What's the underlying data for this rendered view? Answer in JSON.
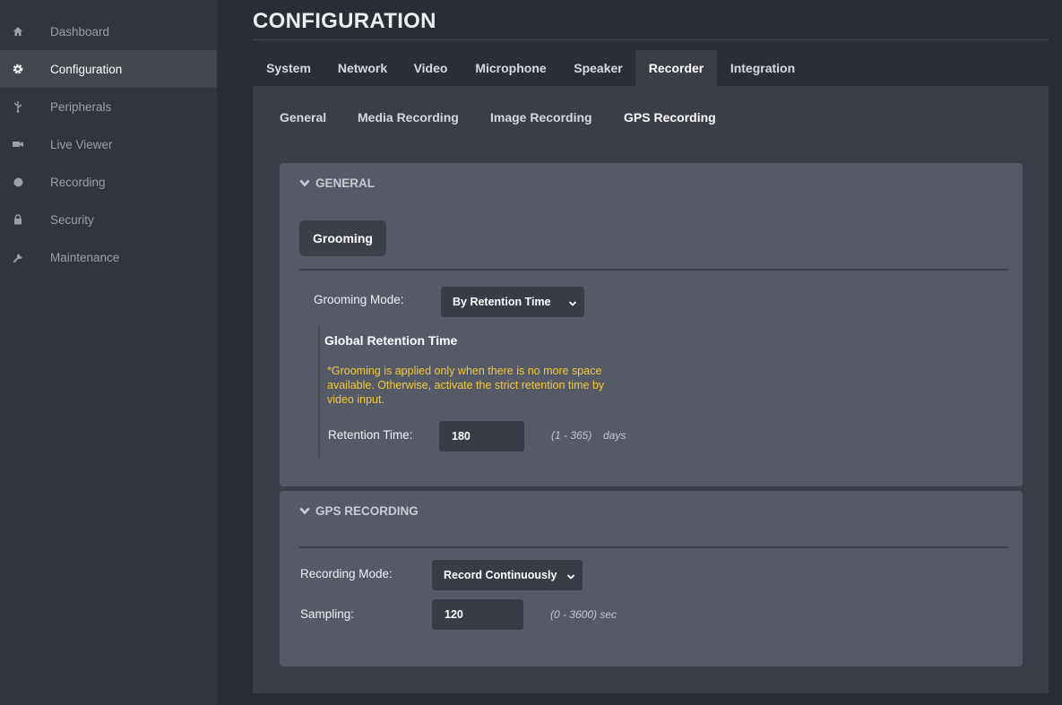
{
  "sidebar": {
    "items": [
      {
        "label": "Dashboard",
        "icon": "home-icon",
        "active": false
      },
      {
        "label": "Configuration",
        "icon": "gear-icon",
        "active": true
      },
      {
        "label": "Peripherals",
        "icon": "usb-icon",
        "active": false
      },
      {
        "label": "Live Viewer",
        "icon": "camera-icon",
        "active": false
      },
      {
        "label": "Recording",
        "icon": "record-dot-icon",
        "active": false
      },
      {
        "label": "Security",
        "icon": "lock-icon",
        "active": false
      },
      {
        "label": "Maintenance",
        "icon": "wrench-icon",
        "active": false
      }
    ]
  },
  "page": {
    "title": "CONFIGURATION"
  },
  "tabs": [
    {
      "label": "System"
    },
    {
      "label": "Network"
    },
    {
      "label": "Video"
    },
    {
      "label": "Microphone"
    },
    {
      "label": "Speaker"
    },
    {
      "label": "Recorder",
      "active": true
    },
    {
      "label": "Integration"
    }
  ],
  "subtabs": [
    {
      "label": "General"
    },
    {
      "label": "Media Recording"
    },
    {
      "label": "Image Recording"
    },
    {
      "label": "GPS Recording",
      "active": true
    }
  ],
  "general": {
    "header": "GENERAL",
    "pill": "Grooming",
    "grooming_mode_label": "Grooming Mode:",
    "grooming_mode_value": "By Retention Time",
    "retention_title": "Global Retention Time",
    "warning": "*Grooming is applied only when there is no more space available. Otherwise, activate the strict retention time by video input.",
    "retention_label": "Retention Time:",
    "retention_value": "180",
    "retention_range": "(1 - 365)",
    "retention_unit": "days"
  },
  "gps": {
    "header": "GPS RECORDING",
    "recording_mode_label": "Recording Mode:",
    "recording_mode_value": "Record Continuously",
    "sampling_label": "Sampling:",
    "sampling_value": "120",
    "sampling_range": "(0 - 3600) sec"
  },
  "colors": {
    "accent_warning": "#f0c93a",
    "sidebar_active": "#43464d",
    "card": "#565a66"
  }
}
